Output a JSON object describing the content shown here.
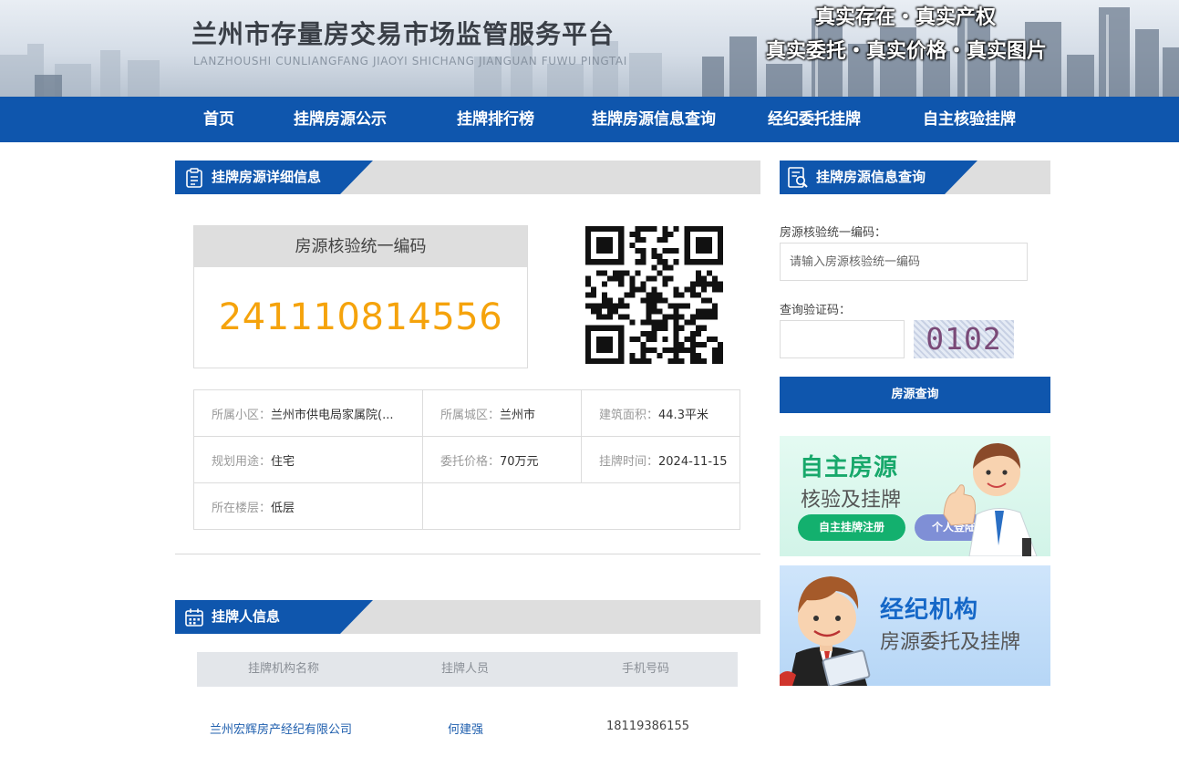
{
  "header": {
    "title": "兰州市存量房交易市场监管服务平台",
    "pinyin": "LANZHOUSHI CUNLIANGFANG JIAOYI SHICHANG JIANGUAN FUWU PINGTAI",
    "slogan_line1": "真实存在・真实产权",
    "slogan_line2": "真实委托・真实价格・真实图片"
  },
  "nav": {
    "items": [
      "首页",
      "挂牌房源公示",
      "挂牌排行榜",
      "挂牌房源信息查询",
      "经纪委托挂牌",
      "自主核验挂牌"
    ]
  },
  "detail": {
    "section_title": "挂牌房源详细信息",
    "code_label": "房源核验统一编码",
    "code_value": "241110814556",
    "info": [
      [
        {
          "k": "所属小区：",
          "v": "兰州市供电局家属院(..."
        },
        {
          "k": "所属城区：",
          "v": "兰州市"
        },
        {
          "k": "建筑面积：",
          "v": "44.3平米"
        }
      ],
      [
        {
          "k": "规划用途：",
          "v": "住宅"
        },
        {
          "k": "委托价格：",
          "v": "70万元"
        },
        {
          "k": "挂牌时间：",
          "v": "2024-11-15"
        }
      ],
      [
        {
          "k": "所在楼层：",
          "v": "低层"
        }
      ]
    ]
  },
  "lister": {
    "section_title": "挂牌人信息",
    "columns": [
      "挂牌机构名称",
      "挂牌人员",
      "手机号码"
    ],
    "row": {
      "agency": "兰州宏辉房产经纪有限公司",
      "person": "何建强",
      "phone": "18119386155"
    }
  },
  "sidebar": {
    "section_title": "挂牌房源信息查询",
    "code_field_label": "房源核验统一编码：",
    "code_field_placeholder": "请输入房源核验统一编码",
    "captcha_label": "查询验证码：",
    "captcha_text": "0102",
    "query_button": "房源查询"
  },
  "promo1": {
    "title": "自主房源",
    "subtitle": "核验及挂牌",
    "register_button": "自主挂牌注册",
    "login_button": "个人登陆"
  },
  "promo2": {
    "title": "经纪机构",
    "subtitle": "房源委托及挂牌"
  },
  "colors": {
    "brand_blue": "#0f56ad",
    "code_orange": "#f5a30c",
    "link_blue": "#1f5fae",
    "promo_green": "#13b06e"
  }
}
